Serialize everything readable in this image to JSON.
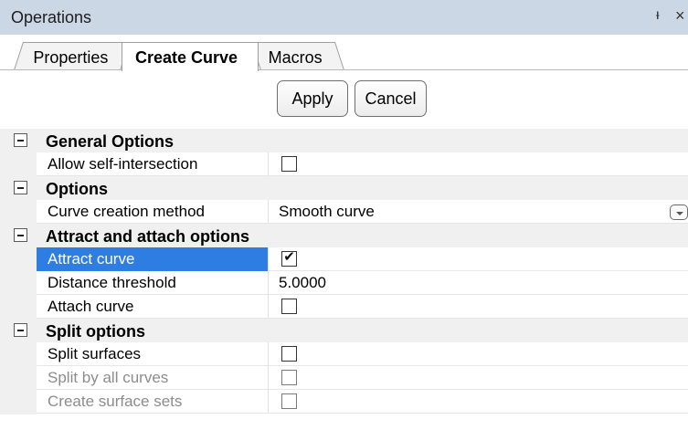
{
  "window": {
    "title": "Operations",
    "pin_glyph": "ᵻ",
    "close_glyph": "×"
  },
  "tabs": [
    {
      "label": "Properties",
      "active": false
    },
    {
      "label": "Create Curve",
      "active": true
    },
    {
      "label": "Macros",
      "active": false
    }
  ],
  "buttons": {
    "apply": "Apply",
    "cancel": "Cancel"
  },
  "grid": {
    "general": {
      "label": "General Options",
      "allow_self_intersection": {
        "label": "Allow self-intersection",
        "checked": false
      }
    },
    "options": {
      "label": "Options",
      "curve_creation_method": {
        "label": "Curve creation method",
        "value": "Smooth curve"
      }
    },
    "attract": {
      "label": "Attract and attach options",
      "attract_curve": {
        "label": "Attract curve",
        "checked": true,
        "selected": true
      },
      "distance_threshold": {
        "label": "Distance threshold",
        "value": "5.0000"
      },
      "attach_curve": {
        "label": "Attach curve",
        "checked": false
      }
    },
    "split": {
      "label": "Split options",
      "split_surfaces": {
        "label": "Split surfaces",
        "checked": false
      },
      "split_by_all_curves": {
        "label": "Split by all curves",
        "checked": false,
        "disabled": true
      },
      "create_surface_sets": {
        "label": "Create surface sets",
        "checked": false,
        "disabled": true
      }
    }
  },
  "colors": {
    "titlebar": "#ccd7e6",
    "selection": "#2e7de2",
    "category_bg": "#f0f0f0"
  }
}
